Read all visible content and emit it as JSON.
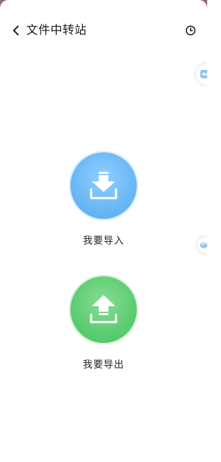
{
  "header": {
    "title": "文件中转站"
  },
  "actions": {
    "import_label": "我要导入",
    "export_label": "我要导出"
  },
  "colors": {
    "import_circle": "#69b6f5",
    "export_circle": "#5ccc72",
    "title_text": "#1b1b1b"
  },
  "icons": {
    "back": "chevron-left-icon",
    "history": "clock-icon",
    "import": "download-tray-icon",
    "export": "upload-tray-icon"
  }
}
